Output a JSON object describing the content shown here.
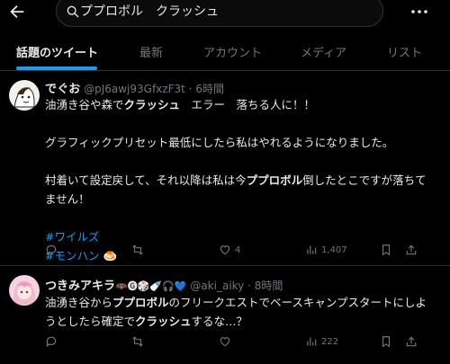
{
  "search": {
    "query": "ププロボル　クラッシュ"
  },
  "tabs": [
    {
      "label": "話題のツイート",
      "active": true
    },
    {
      "label": "最新"
    },
    {
      "label": "アカウント"
    },
    {
      "label": "メディア"
    },
    {
      "label": "リスト"
    }
  ],
  "posts": [
    {
      "name": "でぐお",
      "handle": "@pJ6awj93GfxzF3t",
      "dot": "·",
      "time": "6時間",
      "lines": [
        [
          "油湧き谷や森で",
          "クラッシュ",
          "　エラー　落ちる人に！！"
        ],
        [
          "グラフィックプリセット最低にしたら私はやれるようになりました。"
        ],
        [
          "村着いて設定戻して、それ以降は私は今",
          "ププロボル",
          "倒したとこですが落ちて"
        ],
        [
          "ません！"
        ]
      ],
      "hashtags": [
        "#ワイルズ",
        "#モンハン"
      ],
      "hashtag_emoji": "🍮",
      "counts": {
        "reply": "",
        "retweet": "",
        "like": "4",
        "views": "1,407"
      }
    },
    {
      "name": "つきみアキラ",
      "name_emoji": "🦇🅖🎲🍼🎧💙",
      "handle": "@aki_aiky",
      "dot": "·",
      "time": "8時間",
      "lines": [
        [
          "油湧き谷から",
          "ププロボル",
          "のフリークエストでベースキャンプスタートにしよ"
        ],
        [
          "うとしたら確定で",
          "クラッシュ",
          "するな…？"
        ]
      ],
      "counts": {
        "reply": "",
        "retweet": "",
        "like": "",
        "views": "222"
      }
    }
  ],
  "colors": {
    "accent": "#1d9bf0",
    "muted": "#71767b",
    "text": "#e7e9ea",
    "border": "#2f3336"
  }
}
